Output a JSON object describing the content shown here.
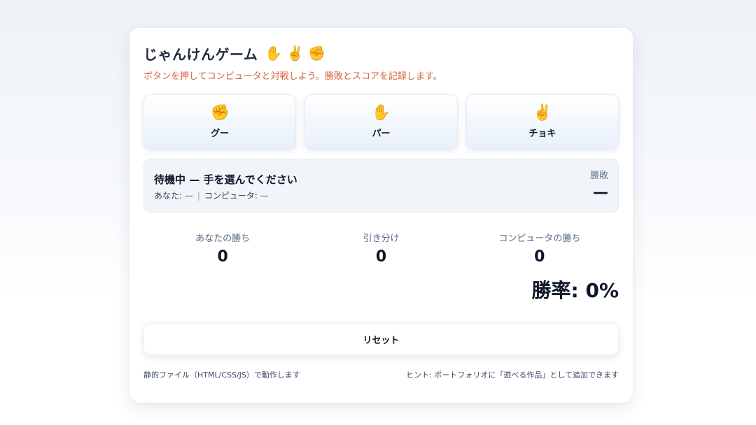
{
  "header": {
    "title": "じゃんけんゲーム",
    "icons": [
      "✋",
      "✌️",
      "✊"
    ],
    "subtitle": "ボタンを押してコンピュータと対戦しよう。勝敗とスコアを記録します。"
  },
  "choices": [
    {
      "icon": "✊",
      "label": "グー"
    },
    {
      "icon": "✋",
      "label": "パー"
    },
    {
      "icon": "✌️",
      "label": "チョキ"
    }
  ],
  "status": {
    "title": "待機中 — 手を選んでください",
    "you_text": "あなた: —",
    "separator": "|",
    "computer_text": "コンピュータ: —",
    "result_label": "勝敗",
    "result_value": "—"
  },
  "scores": [
    {
      "label": "あなたの勝ち",
      "value": "0"
    },
    {
      "label": "引き分け",
      "value": "0"
    },
    {
      "label": "コンピュータの勝ち",
      "value": "0"
    }
  ],
  "winrate": "勝率: 0%",
  "reset_label": "リセット",
  "footer": {
    "left": "静的ファイル（HTML/CSS/JS）で動作します",
    "right": "ヒント: ポートフォリオに「遊べる作品」として追加できます"
  }
}
